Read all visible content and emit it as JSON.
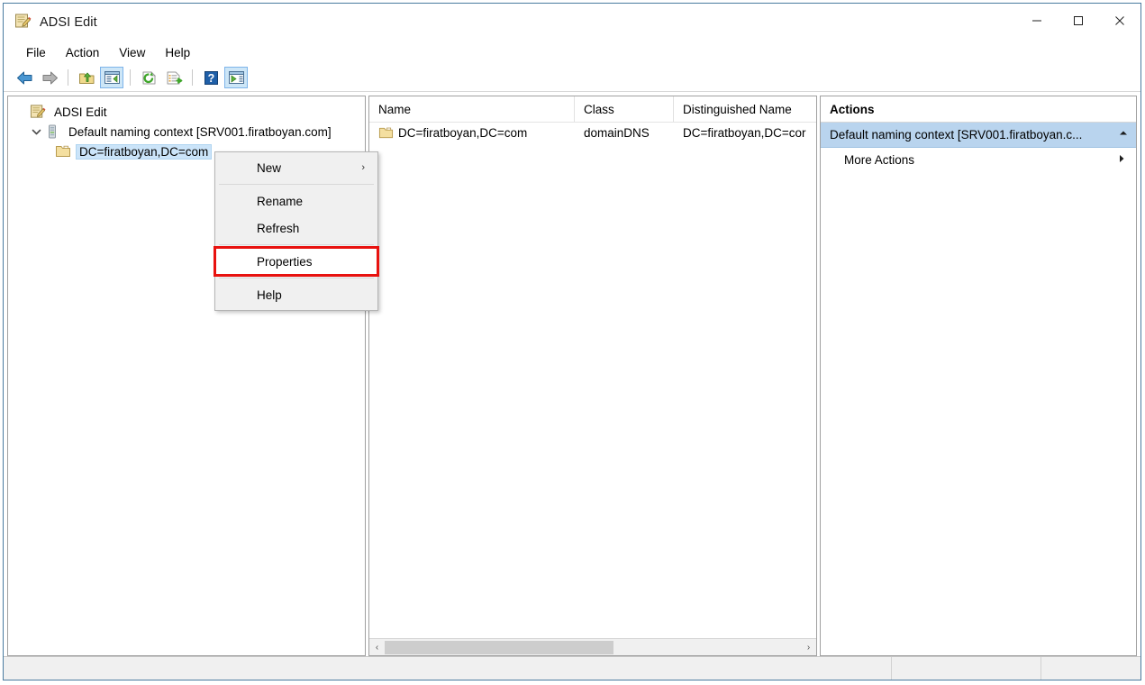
{
  "window": {
    "title": "ADSI Edit",
    "icon": "adsi-edit-icon",
    "buttons": {
      "minimize": "—",
      "maximize": "□",
      "close": "✕"
    }
  },
  "menubar": {
    "items": [
      {
        "label": "File"
      },
      {
        "label": "Action"
      },
      {
        "label": "View"
      },
      {
        "label": "Help"
      }
    ]
  },
  "toolbar": {
    "buttons": [
      {
        "name": "back-icon",
        "pressed": false
      },
      {
        "name": "forward-icon",
        "pressed": false
      },
      {
        "name": "up-folder-icon",
        "pressed": false
      },
      {
        "name": "show-tree-pane-icon",
        "pressed": true
      },
      {
        "name": "refresh-icon",
        "pressed": false
      },
      {
        "name": "export-list-icon",
        "pressed": false
      },
      {
        "name": "help-icon",
        "pressed": false
      },
      {
        "name": "show-action-pane-icon",
        "pressed": true
      }
    ]
  },
  "tree": {
    "nodes": [
      {
        "label": "ADSI Edit",
        "icon": "adsi-edit-icon",
        "level": 0,
        "expander": "none",
        "selected": false
      },
      {
        "label": "Default naming context [SRV001.firatboyan.com]",
        "icon": "naming-context-icon",
        "level": 1,
        "expander": "expanded",
        "selected": false
      },
      {
        "label": "DC=firatboyan,DC=com",
        "icon": "folder-icon",
        "level": 2,
        "expander": "none",
        "selected": true
      }
    ]
  },
  "list": {
    "columns": [
      {
        "label": "Name"
      },
      {
        "label": "Class"
      },
      {
        "label": "Distinguished Name"
      }
    ],
    "rows": [
      {
        "icon": "folder-icon",
        "name": "DC=firatboyan,DC=com",
        "class": "domainDNS",
        "dn": "DC=firatboyan,DC=cor"
      }
    ],
    "scrollbar": {
      "left_arrow": "‹",
      "right_arrow": "›",
      "thumb_percent": 55
    }
  },
  "actions": {
    "header": "Actions",
    "group": {
      "label": "Default naming context [SRV001.firatboyan.c...",
      "collapse_icon": "chevron-up-icon"
    },
    "items": [
      {
        "label": "More Actions",
        "submenu_icon": "chevron-right-icon"
      }
    ]
  },
  "context_menu": {
    "items": [
      {
        "label": "New",
        "submenu": "›",
        "highlighted": false,
        "separator_after": true
      },
      {
        "label": "Rename",
        "submenu": "",
        "highlighted": false,
        "separator_after": false
      },
      {
        "label": "Refresh",
        "submenu": "",
        "highlighted": false,
        "separator_after": true
      },
      {
        "label": "Properties",
        "submenu": "",
        "highlighted": true,
        "separator_after": true
      },
      {
        "label": "Help",
        "submenu": "",
        "highlighted": false,
        "separator_after": false
      }
    ]
  },
  "statusbar": {
    "main": "",
    "segment_b": "",
    "segment_c": ""
  },
  "colors": {
    "window_border": "#4a7ba0",
    "selection": "#cbe4f9",
    "action_group": "#b9d4ee",
    "toolbar_pressed": "#cde6f7",
    "highlight_box": "#e8120f"
  }
}
